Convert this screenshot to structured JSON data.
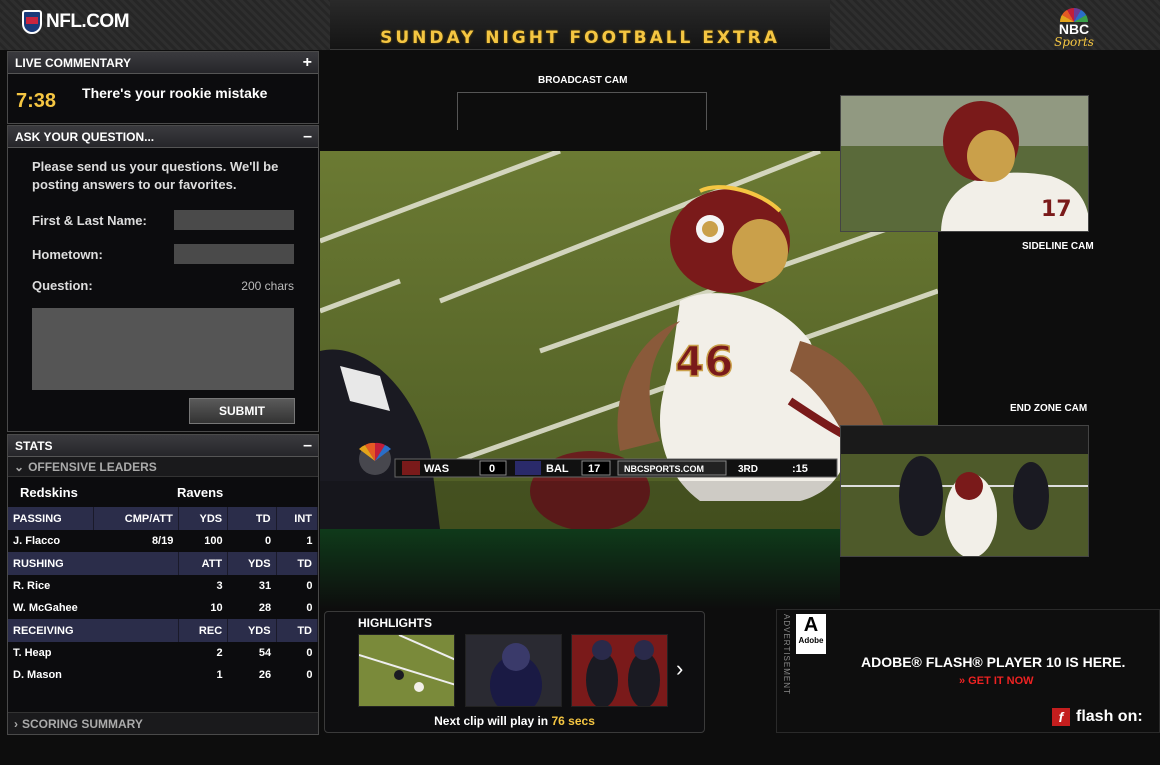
{
  "header": {
    "nfl_logo_text": "NFL.COM",
    "title": "SUNDAY NIGHT FOOTBALL EXTRA",
    "nbc_logo_text": "NBC",
    "nbc_logo_sub": "Sports"
  },
  "live_commentary": {
    "title": "LIVE COMMENTARY",
    "toggle": "+",
    "time": "7:38",
    "text": "There's your rookie mistake"
  },
  "ask_question": {
    "title": "ASK YOUR QUESTION...",
    "toggle": "–",
    "intro": "Please send us your questions.  We'll be posting answers to our favorites.",
    "name_label": "First & Last Name:",
    "hometown_label": "Hometown:",
    "question_label": "Question:",
    "chars_remaining": "200 chars",
    "submit_label": "SUBMIT"
  },
  "stats": {
    "title": "STATS",
    "toggle": "–",
    "offensive_leaders": "OFFENSIVE LEADERS",
    "teams": [
      "Redskins",
      "Ravens"
    ],
    "passing": {
      "header": [
        "PASSING",
        "CMP/ATT",
        "YDS",
        "TD",
        "INT"
      ],
      "rows": [
        [
          "J. Flacco",
          "8/19",
          "100",
          "0",
          "1"
        ]
      ]
    },
    "rushing": {
      "header": [
        "RUSHING",
        "ATT",
        "YDS",
        "TD"
      ],
      "rows": [
        [
          "R. Rice",
          "3",
          "31",
          "0"
        ],
        [
          "W. McGahee",
          "10",
          "28",
          "0"
        ]
      ]
    },
    "receiving": {
      "header": [
        "RECEIVING",
        "REC",
        "YDS",
        "TD"
      ],
      "rows": [
        [
          "T. Heap",
          "2",
          "54",
          "0"
        ],
        [
          "D. Mason",
          "1",
          "26",
          "0"
        ]
      ]
    },
    "scoring_summary": "SCORING SUMMARY"
  },
  "cameras": {
    "broadcast": "BROADCAST CAM",
    "sideline": "SIDELINE CAM",
    "endzone": "END ZONE CAM"
  },
  "scorebug": {
    "team1": "WAS",
    "score1": "0",
    "team2": "BAL",
    "score2": "17",
    "site": "NBCSPORTS.COM",
    "quarter": "3RD",
    "clock": ":15",
    "jersey": "46"
  },
  "highlights": {
    "title": "HIGHLIGHTS",
    "next_prefix": "Next clip will play in",
    "next_secs": "76 secs"
  },
  "ad": {
    "vertical_label": "ADVERTISEMENT",
    "adobe_word": "Adobe",
    "headline": "ADOBE® FLASH® PLAYER 10 IS HERE.",
    "cta": "» GET IT NOW",
    "flash_on": "flash on:"
  },
  "colors": {
    "accent_gold": "#f5c642",
    "panel_header": "#2b2d4a",
    "cta_red": "#e22222"
  }
}
